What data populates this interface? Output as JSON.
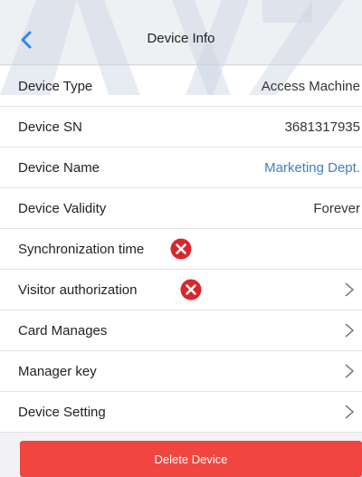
{
  "nav": {
    "title": "Device Info"
  },
  "rows": [
    {
      "label": "Device Type",
      "value": "Access Machine"
    },
    {
      "label": "Device SN",
      "value": "3681317935"
    },
    {
      "label": "Device Name",
      "value": "Marketing Dept."
    },
    {
      "label": "Device Validity",
      "value": "Forever"
    },
    {
      "label": "Synchronization time",
      "status": "error"
    },
    {
      "label": "Visitor authorization",
      "status": "error",
      "action": ">"
    },
    {
      "label": "Card Manages",
      "action": ">"
    },
    {
      "label": "Manager key",
      "action": ">"
    },
    {
      "label": "Device Setting",
      "action": ">"
    }
  ],
  "footer": {
    "delete_label": "Delete Device"
  },
  "icons": {
    "back": "chevron-left-icon",
    "error": "error-x-icon",
    "chevron": "chevron-right-icon"
  },
  "colors": {
    "accent_blue": "#2f86e8",
    "link_blue": "#3d7fc4",
    "error_red": "#d9262b",
    "delete_red": "#f0463f",
    "watermark": "#c9d3e3"
  }
}
